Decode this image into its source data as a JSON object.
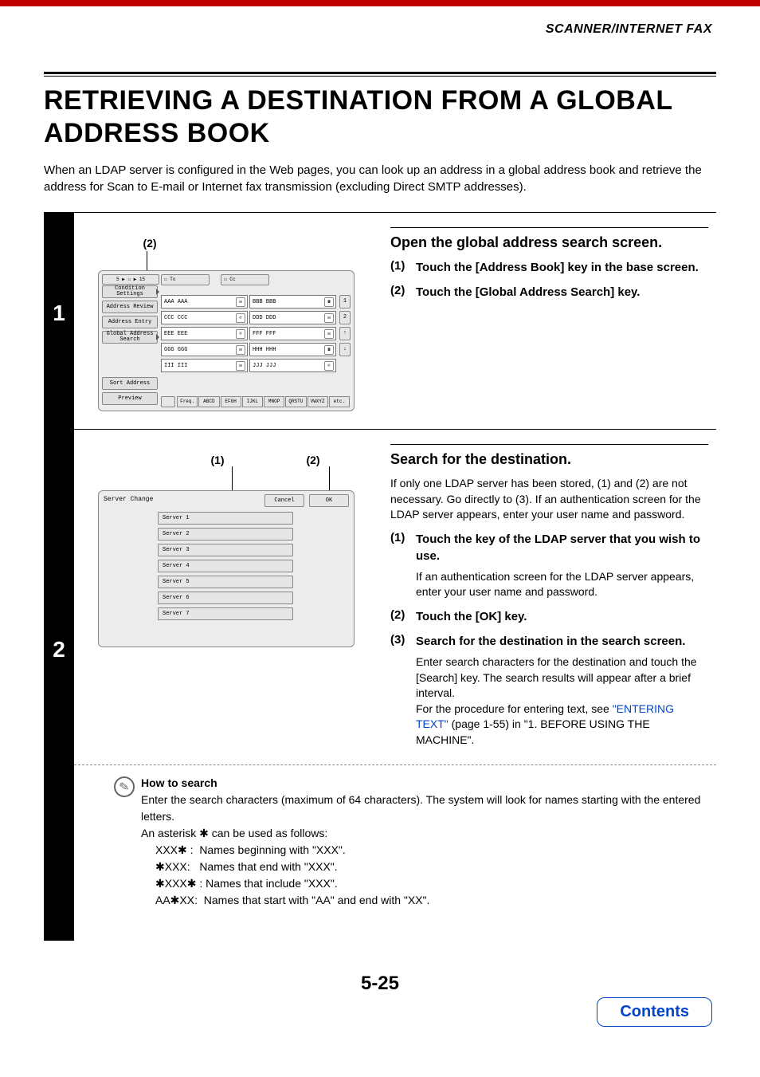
{
  "header": {
    "section": "SCANNER/INTERNET FAX"
  },
  "title": "RETRIEVING A DESTINATION FROM A GLOBAL ADDRESS BOOK",
  "intro": "When an LDAP server is configured in the Web pages, you can look up an address in a global address book and retrieve the address for Scan to E-mail or Internet fax transmission (excluding Direct SMTP addresses).",
  "page_number": "5-25",
  "contents_label": "Contents",
  "step1": {
    "num": "1",
    "callout": "(2)",
    "heading": "Open the global address search screen.",
    "items": [
      {
        "n": "(1)",
        "t": "Touch the [Address Book] key in the base screen."
      },
      {
        "n": "(2)",
        "t": "Touch the [Global Address Search] key."
      }
    ],
    "screen": {
      "topbar": "5 ▶ ⌂ ▶ 15",
      "left_buttons": [
        "Condition\nSettings",
        "Address Review",
        "Address Entry",
        "Global\nAddress Search"
      ],
      "sort_label": "Sort Address",
      "preview_label": "Preview",
      "tab1": "☐ To",
      "tab2": "☐ Cc",
      "cells": [
        [
          "AAA AAA",
          "BBB BBB"
        ],
        [
          "CCC CCC",
          "DDD DDD"
        ],
        [
          "EEE EEE",
          "FFF FFF"
        ],
        [
          "GGG GGG",
          "HHH HHH"
        ],
        [
          "III III",
          "JJJ JJJ"
        ]
      ],
      "side": [
        "1",
        "2",
        "",
        ""
      ],
      "sort_tabs": [
        "Freq.",
        "ABCD",
        "EFGH",
        "IJKL",
        "MNOP",
        "QRSTU",
        "VWXYZ",
        "etc."
      ]
    }
  },
  "step2": {
    "num": "2",
    "callout1": "(1)",
    "callout2": "(2)",
    "heading": "Search for the destination.",
    "note_top": "If only one LDAP server has been stored, (1) and (2) are not necessary. Go directly to (3). If an authentication screen for the LDAP server appears, enter your user name and password.",
    "items": [
      {
        "n": "(1)",
        "t": "Touch the key of the LDAP server that you wish to use.",
        "sub": "If an authentication screen for the LDAP server appears, enter your user name and password."
      },
      {
        "n": "(2)",
        "t": "Touch the [OK] key."
      },
      {
        "n": "(3)",
        "t": "Search for the destination in the search screen.",
        "sub_pre": "Enter search characters for the destination and touch the [Search] key. The search results will appear after a brief interval.",
        "sub2_prefix": "For the procedure for entering text, see ",
        "sub2_link": "\"ENTERING TEXT\"",
        "sub2_suffix": " (page 1-55) in \"1. BEFORE USING THE MACHINE\"."
      }
    ],
    "screen": {
      "title": "Server Change",
      "cancel": "Cancel",
      "ok": "OK",
      "servers": [
        "Server 1",
        "Server 2",
        "Server 3",
        "Server 4",
        "Server 5",
        "Server 6",
        "Server 7"
      ]
    }
  },
  "note": {
    "title": "How to search",
    "line1": "Enter the search characters (maximum of 64 characters). The system will look for names starting with the entered letters.",
    "line2": "An asterisk ✱ can be used as follows:",
    "rows": [
      {
        "p": "XXX✱ :",
        "d": "Names beginning with \"XXX\"."
      },
      {
        "p": "✱XXX:",
        "d": "Names that end with \"XXX\"."
      },
      {
        "p": "✱XXX✱ :",
        "d": "Names that include \"XXX\"."
      },
      {
        "p": "AA✱XX:",
        "d": "Names that start with \"AA\" and end with \"XX\"."
      }
    ]
  }
}
